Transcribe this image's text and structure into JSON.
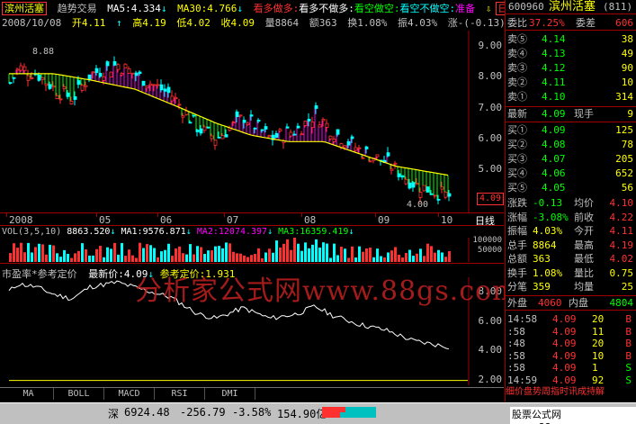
{
  "header": {
    "stock_name": "滨州活塞",
    "indicator_name": "趋势交易",
    "ma5": "MA5:4.334",
    "ma30": "MA30:4.766",
    "legend_items": [
      {
        "label": "看多做多",
        "color": "#ff3030"
      },
      {
        "label": "看多不做多",
        "color": "#ffffff"
      },
      {
        "label": "看空做空",
        "color": "#00ff00"
      },
      {
        "label": "看空不做空",
        "color": "#00ffff"
      },
      {
        "label": "准备",
        "color": "#ff00ff"
      }
    ],
    "date": "2008/10/08",
    "open": "开4.11",
    "high": "高4.19",
    "low": "低4.02",
    "close": "收4.09",
    "volume": "量8864",
    "amount": "额363",
    "turnover": "换1.08%",
    "amplitude": "振4.03%",
    "change": "涨-(-0.13)-3"
  },
  "price_axis": [
    "9.00",
    "8.00",
    "7.00",
    "6.00",
    "5.00",
    "4.00"
  ],
  "price_annotations": {
    "high_mark": "8.88",
    "low_mark": "4.00",
    "current_price": "4.09"
  },
  "time_axis": [
    "2008",
    "05",
    "06",
    "07",
    "08",
    "09",
    "10"
  ],
  "period_label": "日线",
  "volume_panel": {
    "title": "VOL(3,5,10)",
    "vol": "8863.520",
    "ma1": "MA1:9576.871",
    "ma2": "MA2:12074.397",
    "ma3": "MA3:16359.419",
    "axis": [
      "100000",
      "50000"
    ]
  },
  "pe_panel": {
    "title": "市盈率*参考定价",
    "latest": "最新价:4.09",
    "reference": "参考定价:1.931",
    "axis": [
      "8.00",
      "6.00",
      "4.00",
      "2.00"
    ]
  },
  "watermark": "分析家公式网www.88gs.com",
  "tabs": [
    "MA",
    "BOLL",
    "MACD",
    "RSI",
    "DMI"
  ],
  "sidebar": {
    "code": "600960",
    "name": "滨州活塞",
    "code_suffix": "(811)",
    "weibi_label": "委比",
    "weibi_value": "37.25%",
    "weicha_label": "委差",
    "weicha_value": "606",
    "asks": [
      {
        "label": "卖⑤",
        "price": "4.14",
        "vol": "38"
      },
      {
        "label": "卖④",
        "price": "4.13",
        "vol": "49"
      },
      {
        "label": "卖③",
        "price": "4.12",
        "vol": "90"
      },
      {
        "label": "卖②",
        "price": "4.11",
        "vol": "10"
      },
      {
        "label": "卖①",
        "price": "4.10",
        "vol": "314"
      }
    ],
    "latest_label": "最新",
    "latest_value": "4.09",
    "current_label": "现手",
    "current_value": "9",
    "bids": [
      {
        "label": "买①",
        "price": "4.09",
        "vol": "125"
      },
      {
        "label": "买②",
        "price": "4.08",
        "vol": "78"
      },
      {
        "label": "买③",
        "price": "4.07",
        "vol": "205"
      },
      {
        "label": "买④",
        "price": "4.06",
        "vol": "652"
      },
      {
        "label": "买⑤",
        "price": "4.05",
        "vol": "56"
      }
    ],
    "stats": [
      {
        "l1": "涨跌",
        "v1": "-0.13",
        "l2": "均价",
        "v2": "4.10"
      },
      {
        "l1": "涨幅",
        "v1": "-3.08%",
        "l2": "前收",
        "v2": "4.22"
      },
      {
        "l1": "振幅",
        "v1": "4.03%",
        "l2": "今开",
        "v2": "4.11"
      },
      {
        "l1": "总手",
        "v1": "8864",
        "l2": "最高",
        "v2": "4.19"
      },
      {
        "l1": "总额",
        "v1": "363",
        "l2": "最低",
        "v2": "4.02"
      },
      {
        "l1": "换手",
        "v1": "1.08%",
        "l2": "量比",
        "v2": "0.75"
      },
      {
        "l1": "分笔",
        "v1": "359",
        "l2": "均量",
        "v2": "25"
      }
    ],
    "outer_label": "外盘",
    "outer_value": "4060",
    "inner_label": "内盘",
    "inner_value": "4804",
    "ticks": [
      {
        "time": "14:58",
        "price": "4.09",
        "vol": "20",
        "bs": "B"
      },
      {
        "time": ":58",
        "price": "4.09",
        "vol": "11",
        "bs": "B"
      },
      {
        "time": ":48",
        "price": "4.09",
        "vol": "20",
        "bs": "B"
      },
      {
        "time": ":58",
        "price": "4.09",
        "vol": "10",
        "bs": "B"
      },
      {
        "time": ":58",
        "price": "4.09",
        "vol": "1",
        "bs": "S"
      },
      {
        "time": "14:59",
        "price": "4.09",
        "vol": "92",
        "bs": "S"
      }
    ],
    "ticker_msg": "细价盘势周指时讯成持解"
  },
  "status": {
    "market": "深",
    "index": "6924.48",
    "change": "-256.79",
    "pct": "-3.58%",
    "amount": "154.90亿",
    "site": "股票公式网www.88gs.com"
  },
  "colors": {
    "up": "#ff3030",
    "down": "#00ffff",
    "yellow": "#ffff00",
    "green": "#00ff00",
    "magenta": "#ff00ff",
    "border": "#a00000"
  }
}
